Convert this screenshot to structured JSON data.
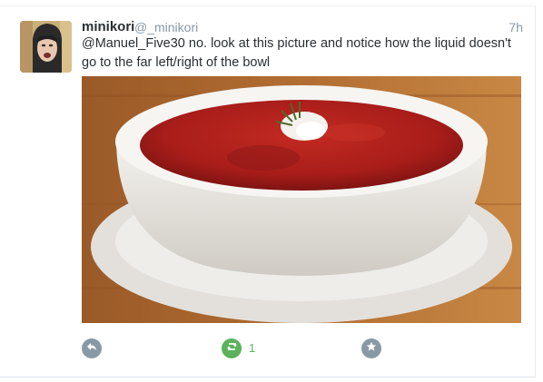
{
  "tweet": {
    "display_name": "minikori",
    "handle": "@_minikori",
    "timestamp": "7h",
    "text": "@Manuel_Five30 no. look at this picture and notice how the liquid doesn't go to the far left/right of the bowl",
    "media": {
      "icon": "photo"
    }
  },
  "actions": {
    "reply_icon": "reply-icon",
    "retweet_icon": "retweet-icon",
    "retweet_count": "1",
    "favorite_icon": "star-icon"
  },
  "colors": {
    "text": "#292f33",
    "muted": "#8899a6",
    "retweet_green": "#5bb25b"
  }
}
